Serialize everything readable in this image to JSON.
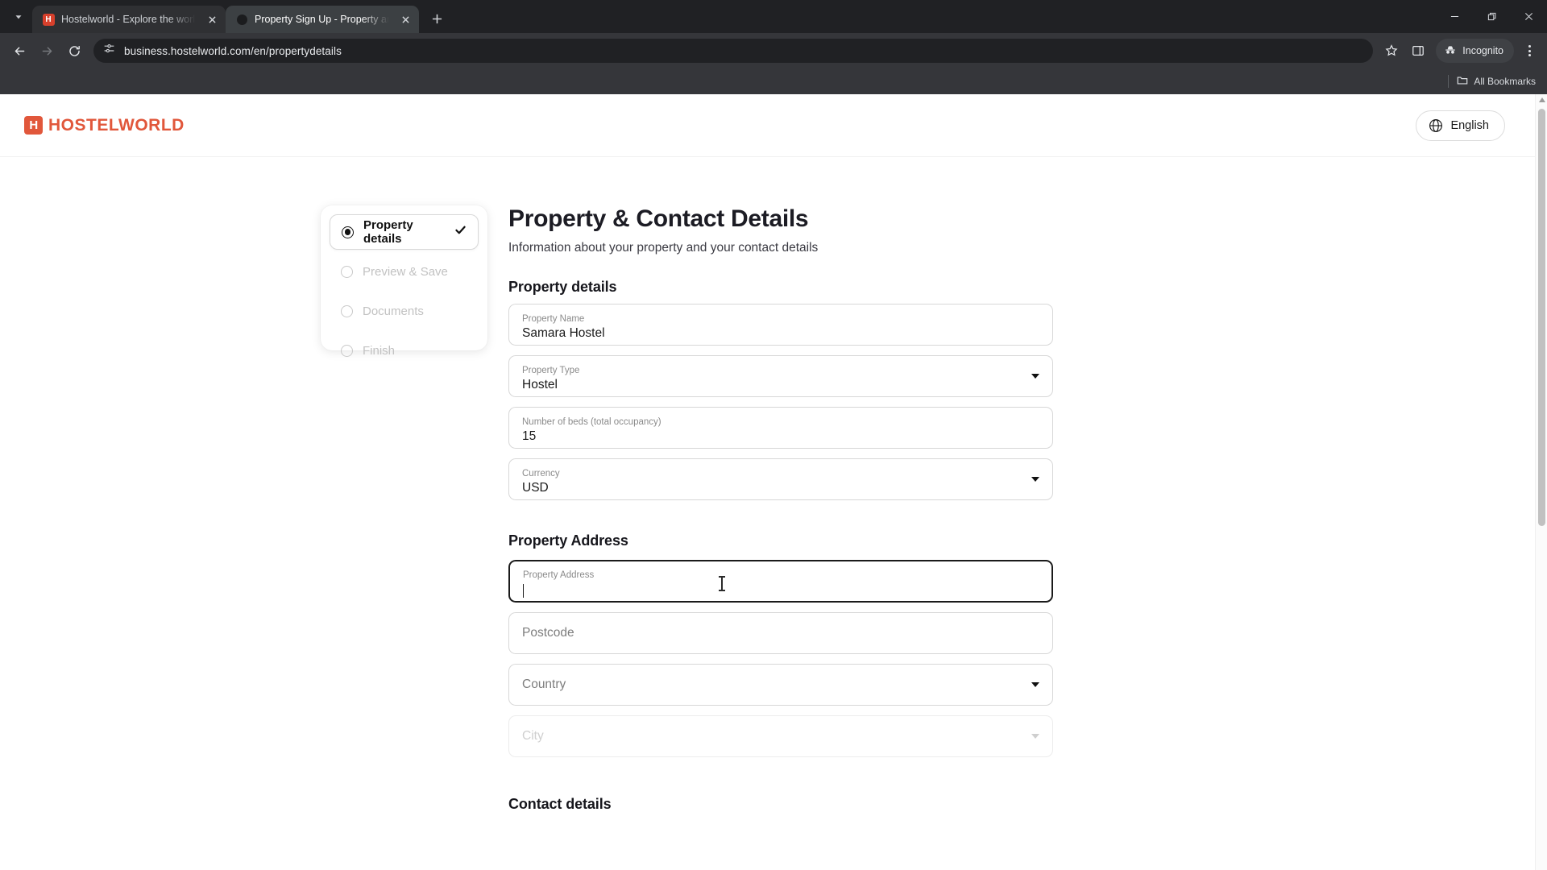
{
  "browser": {
    "tabs": [
      {
        "title": "Hostelworld - Explore the world",
        "favicon": "hostelworld-icon",
        "active": false
      },
      {
        "title": "Property Sign Up - Property and",
        "favicon": "loading-dot-icon",
        "active": true
      }
    ],
    "new_tab_label": "+",
    "url": "business.hostelworld.com/en/propertydetails",
    "profile_label": "Incognito",
    "bookmarks_label": "All Bookmarks",
    "icons": {
      "tab_search": "chevron-down-icon",
      "back": "back-arrow-icon",
      "forward": "forward-arrow-icon",
      "reload": "reload-icon",
      "site_info": "page-settings-icon",
      "bookmark": "star-icon",
      "side_panel": "side-panel-icon",
      "menu": "kebab-menu-icon",
      "minimize": "minimize-icon",
      "maximize": "restore-icon",
      "close": "close-icon",
      "folder": "folder-icon"
    }
  },
  "site": {
    "logo_letter": "H",
    "logo_text": "HOSTELWORLD",
    "brand_color": "#e1573b",
    "language_button": "English"
  },
  "stepper": {
    "steps": [
      {
        "label": "Property details",
        "state": "active",
        "completed": true
      },
      {
        "label": "Preview & Save",
        "state": "upcoming",
        "completed": false
      },
      {
        "label": "Documents",
        "state": "upcoming",
        "completed": false
      },
      {
        "label": "Finish",
        "state": "upcoming",
        "completed": false
      }
    ]
  },
  "page": {
    "title": "Property & Contact Details",
    "subtitle": "Information about your property and your contact details",
    "sections": {
      "property_details": {
        "heading": "Property details",
        "fields": [
          {
            "label": "Property Name",
            "value": "Samara Hostel",
            "type": "text"
          },
          {
            "label": "Property Type",
            "value": "Hostel",
            "type": "select"
          },
          {
            "label": "Number of beds (total occupancy)",
            "value": "15",
            "type": "text"
          },
          {
            "label": "Currency",
            "value": "USD",
            "type": "select"
          }
        ]
      },
      "property_address": {
        "heading": "Property Address",
        "fields": [
          {
            "label": "Property Address",
            "value": "",
            "placeholder": "Property Address",
            "type": "text",
            "focused": true
          },
          {
            "label": "",
            "value": "",
            "placeholder": "Postcode",
            "type": "text"
          },
          {
            "label": "",
            "value": "",
            "placeholder": "Country",
            "type": "select"
          },
          {
            "label": "",
            "value": "",
            "placeholder": "City",
            "type": "select",
            "disabled": true
          }
        ]
      },
      "contact_details": {
        "heading": "Contact details"
      }
    }
  }
}
